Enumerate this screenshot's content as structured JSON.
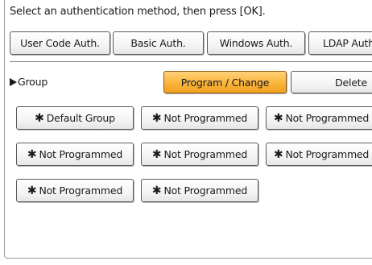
{
  "instruction": "Select an authentication method, then press [OK].",
  "auth_tabs": [
    {
      "label": "User Code Auth."
    },
    {
      "label": "Basic Auth."
    },
    {
      "label": "Windows Auth."
    },
    {
      "label": "LDAP Auth"
    }
  ],
  "group": {
    "label": "Group",
    "program_change_label": "Program / Change",
    "delete_label": "Delete"
  },
  "star_glyph": "✱",
  "group_buttons": [
    {
      "label": "Default Group"
    },
    {
      "label": "Not Programmed"
    },
    {
      "label": "Not Programmed"
    },
    {
      "label": "Not Programmed"
    },
    {
      "label": "Not Programmed"
    },
    {
      "label": "Not Programmed"
    },
    {
      "label": "Not Programmed"
    },
    {
      "label": "Not Programmed"
    }
  ],
  "colors": {
    "accent_orange": "#f9b43c",
    "border": "#5a5a5a"
  }
}
